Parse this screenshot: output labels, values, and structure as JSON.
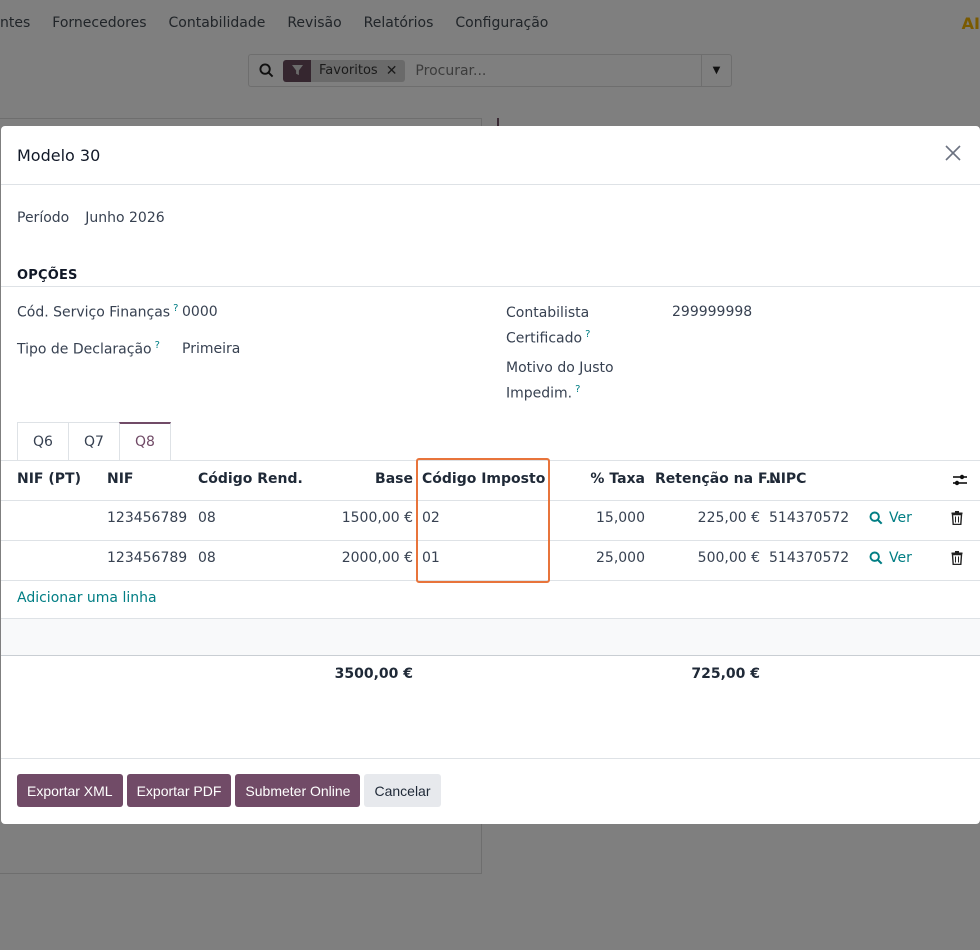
{
  "navbar": {
    "items": [
      "ntes",
      "Fornecedores",
      "Contabilidade",
      "Revisão",
      "Relatórios",
      "Configuração"
    ],
    "logo": "AI"
  },
  "search": {
    "facet_label": "Favoritos",
    "placeholder": "Procurar..."
  },
  "modal": {
    "title": "Modelo 30",
    "periodo_label": "Período",
    "periodo_value": "Junho 2026",
    "section_title": "OPÇÕES",
    "tooltip_mark": "?",
    "fields": {
      "servico_label": "Cód. Serviço Finanças",
      "servico_value": "0000",
      "tipo_label": "Tipo de Declaração",
      "tipo_value": "Primeira",
      "contabilista_label_1": "Contabilista",
      "contabilista_label_2": "Certificado",
      "contabilista_value": "299999998",
      "motivo_label_1": "Motivo do Justo",
      "motivo_label_2": "Impedim."
    },
    "tabs": [
      "Q6",
      "Q7",
      "Q8"
    ],
    "active_tab": "Q8",
    "table": {
      "headers": {
        "nif_pt": "NIF (PT)",
        "nif": "NIF",
        "codigo_rend": "Código Rend.",
        "base": "Base",
        "codigo_imposto": "Código Imposto",
        "taxa": "% Taxa",
        "retencao": "Retenção na F...",
        "nipc": "NIPC"
      },
      "rows": [
        {
          "nif_pt": "",
          "nif": "123456789",
          "codigo_rend": "08",
          "base": "1500,00 €",
          "codigo_imposto": "02",
          "taxa": "15,000",
          "retencao": "225,00 €",
          "nipc": "514370572",
          "action": "Ver"
        },
        {
          "nif_pt": "",
          "nif": "123456789",
          "codigo_rend": "08",
          "base": "2000,00 €",
          "codigo_imposto": "01",
          "taxa": "25,000",
          "retencao": "500,00 €",
          "nipc": "514370572",
          "action": "Ver"
        }
      ],
      "add_line": "Adicionar uma linha",
      "totals": {
        "base": "3500,00 €",
        "retencao": "725,00 €"
      }
    },
    "buttons": {
      "export_xml": "Exportar XML",
      "export_pdf": "Exportar PDF",
      "submit": "Submeter Online",
      "cancel": "Cancelar"
    }
  },
  "colors": {
    "primary": "#714b67",
    "link": "#017e84",
    "highlight": "#e8743b"
  }
}
